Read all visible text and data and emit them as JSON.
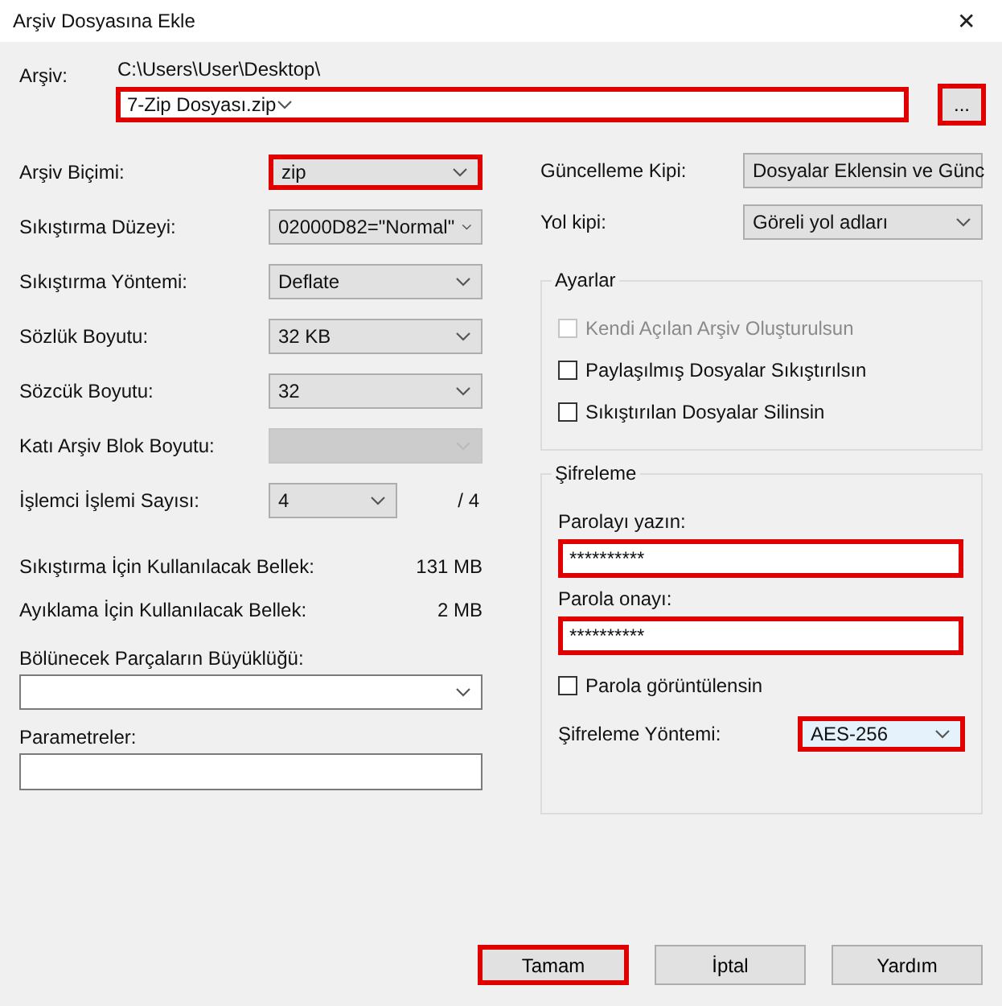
{
  "window": {
    "title": "Arşiv Dosyasına Ekle",
    "close": "✕"
  },
  "archive": {
    "label": "Arşiv:",
    "path": "C:\\Users\\User\\Desktop\\",
    "value": "7-Zip Dosyası.zip",
    "highlighted": true,
    "browse": {
      "label": "...",
      "highlighted": true
    }
  },
  "left_options": [
    {
      "kind": "combo",
      "label": "Arşiv Biçimi:",
      "value": "zip",
      "disabled": false,
      "highlighted": true
    },
    {
      "kind": "combo",
      "label": "Sıkıştırma Düzeyi:",
      "value": "02000D82=\"Normal\"",
      "disabled": false,
      "highlighted": false
    },
    {
      "kind": "combo",
      "label": "Sıkıştırma Yöntemi:",
      "value": "Deflate",
      "disabled": false,
      "highlighted": false
    },
    {
      "kind": "combo",
      "label": "Sözlük Boyutu:",
      "value": "32 KB",
      "disabled": false,
      "highlighted": false
    },
    {
      "kind": "combo",
      "label": "Sözcük Boyutu:",
      "value": "32",
      "disabled": false,
      "highlighted": false
    },
    {
      "kind": "combo",
      "label": "Katı Arşiv Blok Boyutu:",
      "disabled": true,
      "highlighted": false
    },
    {
      "kind": "combo",
      "label": "İşlemci İşlemi Sayısı:",
      "value": "4",
      "suffix": "/ 4",
      "disabled": false,
      "highlighted": false
    },
    {
      "kind": "info",
      "label": "Sıkıştırma İçin Kullanılacak Bellek:",
      "value": "131 MB"
    },
    {
      "kind": "info",
      "label": "Ayıklama İçin Kullanılacak Bellek:",
      "value": "2 MB"
    }
  ],
  "split": {
    "label": "Bölünecek Parçaların Büyüklüğü:"
  },
  "parameters": {
    "label": "Parametreler:"
  },
  "right_options": [
    {
      "label": "Güncelleme Kipi:",
      "value": "Dosyalar Eklensin ve Günc"
    },
    {
      "label": "Yol kipi:",
      "value": "Göreli yol adları"
    }
  ],
  "settings": {
    "title": "Ayarlar",
    "checkboxes": [
      {
        "label": "Kendi Açılan Arşiv Oluşturulsun",
        "checked": false,
        "disabled": true
      },
      {
        "label": "Paylaşılmış Dosyalar Sıkıştırılsın",
        "checked": false,
        "disabled": false
      },
      {
        "label": "Sıkıştırılan Dosyalar Silinsin",
        "checked": false,
        "disabled": false
      }
    ]
  },
  "encryption": {
    "title": "Şifreleme",
    "fields": [
      {
        "label": "Parolayı yazın:",
        "value": "**********",
        "highlighted": true
      },
      {
        "label": "Parola onayı:",
        "value": "**********",
        "highlighted": true
      }
    ],
    "show_password": {
      "label": "Parola görüntülensin",
      "checked": false
    },
    "method": {
      "label": "Şifreleme Yöntemi:",
      "value": "AES-256",
      "highlighted": true
    }
  },
  "buttons": [
    {
      "label": "Tamam",
      "highlighted": true
    },
    {
      "label": "İptal",
      "highlighted": false
    },
    {
      "label": "Yardım",
      "highlighted": false
    }
  ]
}
